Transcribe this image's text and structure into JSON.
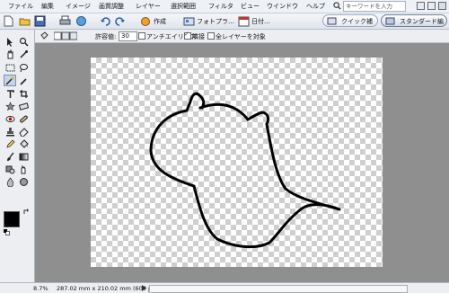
{
  "menu": [
    "ファイル",
    "編集",
    "イメージ",
    "画質調整",
    "レイヤー",
    "選択範囲",
    "フィルタ",
    "ビュー",
    "ウインドウ",
    "ヘルプ"
  ],
  "search": {
    "placeholder": "キーワードを入力"
  },
  "toolbar": {
    "create_label": "作成",
    "photo_label": "フォトプラ…",
    "date_label": "日付…",
    "quick_fix_label": "クイック補正",
    "standard_edit_label": "スタンダード編集"
  },
  "options": {
    "tolerance_label": "許容値:",
    "tolerance_value": "30",
    "antialias_label": "アンチエイリアス",
    "contiguous_label": "隣接",
    "all_layers_label": "全レイヤーを対象"
  },
  "status": {
    "zoom": "8.7%",
    "doc_size": "287.02 mm x 210.02 mm (600 ppi)"
  },
  "colors": {
    "foreground": "#000000",
    "background": "#ffffff"
  }
}
